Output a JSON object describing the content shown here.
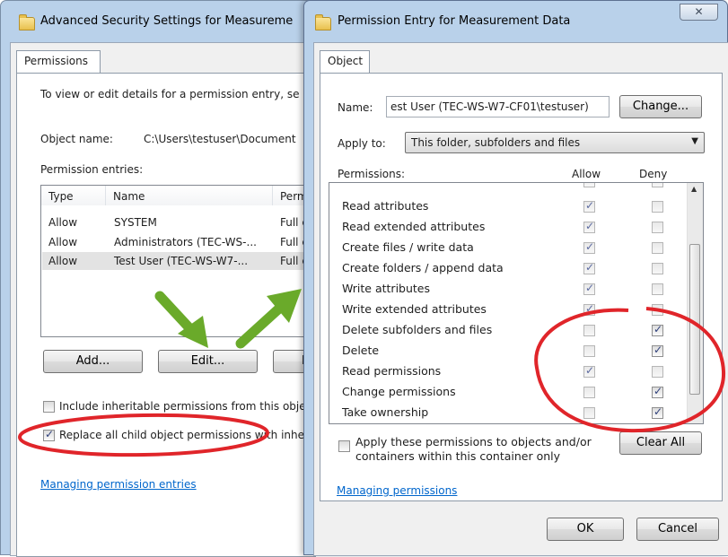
{
  "advanced_dialog": {
    "title": "Advanced Security Settings for Measureme",
    "tab": "Permissions",
    "intro": "To view or edit details for a permission entry, se",
    "object_name_label": "Object name:",
    "object_name_value": "C:\\Users\\testuser\\Document",
    "entries_label": "Permission entries:",
    "columns": [
      "Type",
      "Name",
      "Perm"
    ],
    "rows": [
      {
        "type": "Allow",
        "name": "SYSTEM",
        "perm": "Full c"
      },
      {
        "type": "Allow",
        "name": "Administrators (TEC-WS-...",
        "perm": "Full c"
      },
      {
        "type": "Allow",
        "name": "Test User (TEC-WS-W7-...",
        "perm": "Full c"
      }
    ],
    "add_button": "Add...",
    "edit_button": "Edit...",
    "remove_button_partial": "R",
    "include_inheritable": "Include inheritable permissions from this obje",
    "replace_child": "Replace all child object permissions with inher",
    "link": "Managing permission entries"
  },
  "entry_dialog": {
    "title": "Permission Entry for Measurement Data",
    "close_glyph": "✕",
    "tab": "Object",
    "name_label": "Name:",
    "name_value": "est User (TEC-WS-W7-CF01\\testuser)",
    "change_button": "Change...",
    "apply_to_label": "Apply to:",
    "apply_to_value": "This folder, subfolders and files",
    "permissions_label": "Permissions:",
    "allow_header": "Allow",
    "deny_header": "Deny",
    "permissions": [
      {
        "label": "Read attributes",
        "allow": true,
        "deny": false
      },
      {
        "label": "Read extended attributes",
        "allow": true,
        "deny": false
      },
      {
        "label": "Create files / write data",
        "allow": true,
        "deny": false
      },
      {
        "label": "Create folders / append data",
        "allow": true,
        "deny": false
      },
      {
        "label": "Write attributes",
        "allow": true,
        "deny": false
      },
      {
        "label": "Write extended attributes",
        "allow": true,
        "deny": false
      },
      {
        "label": "Delete subfolders and files",
        "allow": false,
        "deny": true
      },
      {
        "label": "Delete",
        "allow": false,
        "deny": true
      },
      {
        "label": "Read permissions",
        "allow": true,
        "deny": false
      },
      {
        "label": "Change permissions",
        "allow": false,
        "deny": true
      },
      {
        "label": "Take ownership",
        "allow": false,
        "deny": true
      }
    ],
    "apply_only_text_1": "Apply these permissions to objects and/or",
    "apply_only_text_2": "containers within this container only",
    "clear_all_button": "Clear All",
    "link": "Managing permissions",
    "ok_button": "OK",
    "cancel_button": "Cancel"
  },
  "colors": {
    "annotation_red": "#e0252a",
    "arrow_green": "#6aaa2a"
  }
}
